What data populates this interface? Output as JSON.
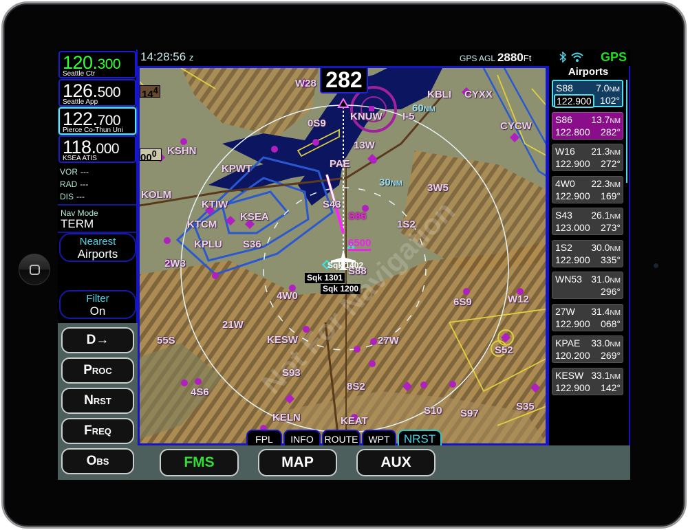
{
  "device": {
    "home_button": "home-button"
  },
  "status": {
    "time": "14:28:56",
    "time_suffix": "z",
    "agl_label": "GPS AGL",
    "agl_value": "2880",
    "agl_unit": "Ft",
    "gps": "GPS",
    "icons": [
      "bluetooth-icon",
      "wifi-icon"
    ]
  },
  "com": [
    {
      "mhz": "120.",
      "khz": "300",
      "label": "Seattle Ctr",
      "state": "active"
    },
    {
      "mhz": "126.",
      "khz": "500",
      "label": "Seattle App",
      "state": ""
    },
    {
      "mhz": "122.",
      "khz": "700",
      "label": "Pierce Co-Thun Uni",
      "state": "selected"
    },
    {
      "mhz": "118.",
      "khz": "000",
      "label": "KSEA ATIS",
      "state": ""
    }
  ],
  "nav": {
    "vor_label": "VOR",
    "vor_value": "---",
    "rad_label": "RAD",
    "rad_value": "---",
    "dis_label": "DIS",
    "dis_value": "---",
    "mode_label": "Nav Mode",
    "mode_value": "TERM"
  },
  "buttons": {
    "nearest_line1": "Nearest",
    "nearest_line2": "Airports",
    "filter_line1": "Filter",
    "filter_line2": "On"
  },
  "softkeys": [
    "D→",
    "Proc",
    "Nrst",
    "Freq",
    "Obs"
  ],
  "bottom_keys": [
    {
      "label": "FMS",
      "active": true
    },
    {
      "label": "MAP",
      "active": false
    },
    {
      "label": "AUX",
      "active": false
    }
  ],
  "map": {
    "heading": "282",
    "alt_tape_top": "14",
    "alt_tape_top_sup": "4",
    "alt_tape_bottom": "00",
    "alt_tape_bottom_sup": "0",
    "selected_altitude": "6500",
    "range_rings": [
      {
        "value": "60",
        "unit": "NM"
      },
      {
        "value": "30",
        "unit": "NM"
      }
    ],
    "traffic": [
      "Sqk 1402",
      "Sqk 1301",
      "Sqk 1200"
    ],
    "airport_labels": [
      "W28",
      "0S9",
      "KNUW",
      "KBLI",
      "CYXX",
      "CYCW",
      "13W",
      "KSHN",
      "KPWT",
      "PAE",
      "3W5",
      "KOLM",
      "KTIW",
      "KSEA",
      "S43",
      "S86",
      "1S2",
      "KTCM",
      "KPLU",
      "S36",
      "2W3",
      "S88",
      "4W0",
      "6S9",
      "W12",
      "21W",
      "KESW",
      "27W",
      "55S",
      "S52",
      "S93",
      "4S6",
      "8S2",
      "KELN",
      "KEAT",
      "S10",
      "S97",
      "S35"
    ],
    "highway_label": "I-5",
    "watermark": "Not For Navigation",
    "tabs": [
      {
        "label": "FPL",
        "active": false
      },
      {
        "label": "INFO",
        "active": false
      },
      {
        "label": "ROUTE",
        "active": false
      },
      {
        "label": "WPT",
        "active": false
      },
      {
        "label": "NRST",
        "active": true
      }
    ],
    "side_tab": "NRST"
  },
  "airports": {
    "title": "Airports",
    "unit": "NM",
    "items": [
      {
        "id": "S88",
        "dist": "7.0",
        "freq": "122.900",
        "brg": "102°",
        "state": "selected"
      },
      {
        "id": "S86",
        "dist": "13.7",
        "freq": "122.800",
        "brg": "282°",
        "state": "magenta"
      },
      {
        "id": "W16",
        "dist": "21.3",
        "freq": "122.900",
        "brg": "272°",
        "state": ""
      },
      {
        "id": "4W0",
        "dist": "22.3",
        "freq": "122.900",
        "brg": "169°",
        "state": ""
      },
      {
        "id": "S43",
        "dist": "26.1",
        "freq": "123.000",
        "brg": "273°",
        "state": ""
      },
      {
        "id": "1S2",
        "dist": "30.0",
        "freq": "122.900",
        "brg": "335°",
        "state": ""
      },
      {
        "id": "WN53",
        "dist": "31.0",
        "freq": "",
        "brg": "296°",
        "state": ""
      },
      {
        "id": "27W",
        "dist": "31.4",
        "freq": "122.900",
        "brg": "068°",
        "state": ""
      },
      {
        "id": "KPAE",
        "dist": "33.0",
        "freq": "120.200",
        "brg": "269°",
        "state": ""
      },
      {
        "id": "KESW",
        "dist": "33.1",
        "freq": "122.900",
        "brg": "142°",
        "state": ""
      }
    ]
  }
}
